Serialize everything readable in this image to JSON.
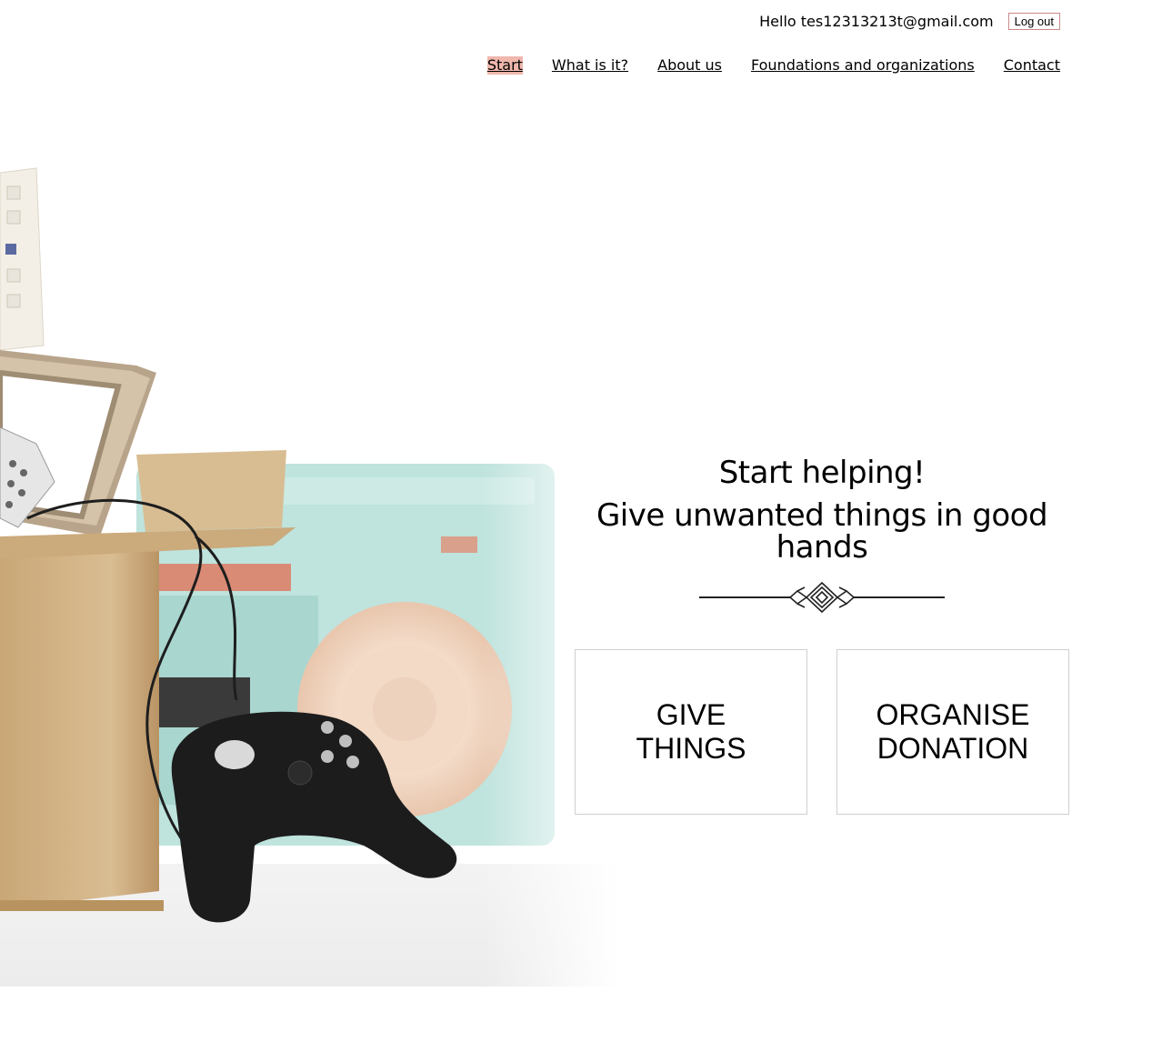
{
  "header": {
    "greeting": "Hello tes12313213t@gmail.com",
    "logout_label": "Log out"
  },
  "nav": {
    "items": [
      {
        "label": "Start",
        "active": true
      },
      {
        "label": "What is it?"
      },
      {
        "label": "About us"
      },
      {
        "label": "Foundations and organizations"
      },
      {
        "label": "Contact"
      }
    ]
  },
  "hero": {
    "title": "Start helping!",
    "subtitle": "Give unwanted things in good hands",
    "image_alt": "box-with-unwanted-items-illustration",
    "decoration_icon": "ornament-divider-icon"
  },
  "actions": {
    "give_things": "GIVE\nTHINGS",
    "organise_donation": "ORGANISE\nDONATION"
  },
  "colors": {
    "active_nav_bg": "#f0b7ad",
    "logout_border": "#c98a8a",
    "card_border": "#cfcfcf"
  }
}
